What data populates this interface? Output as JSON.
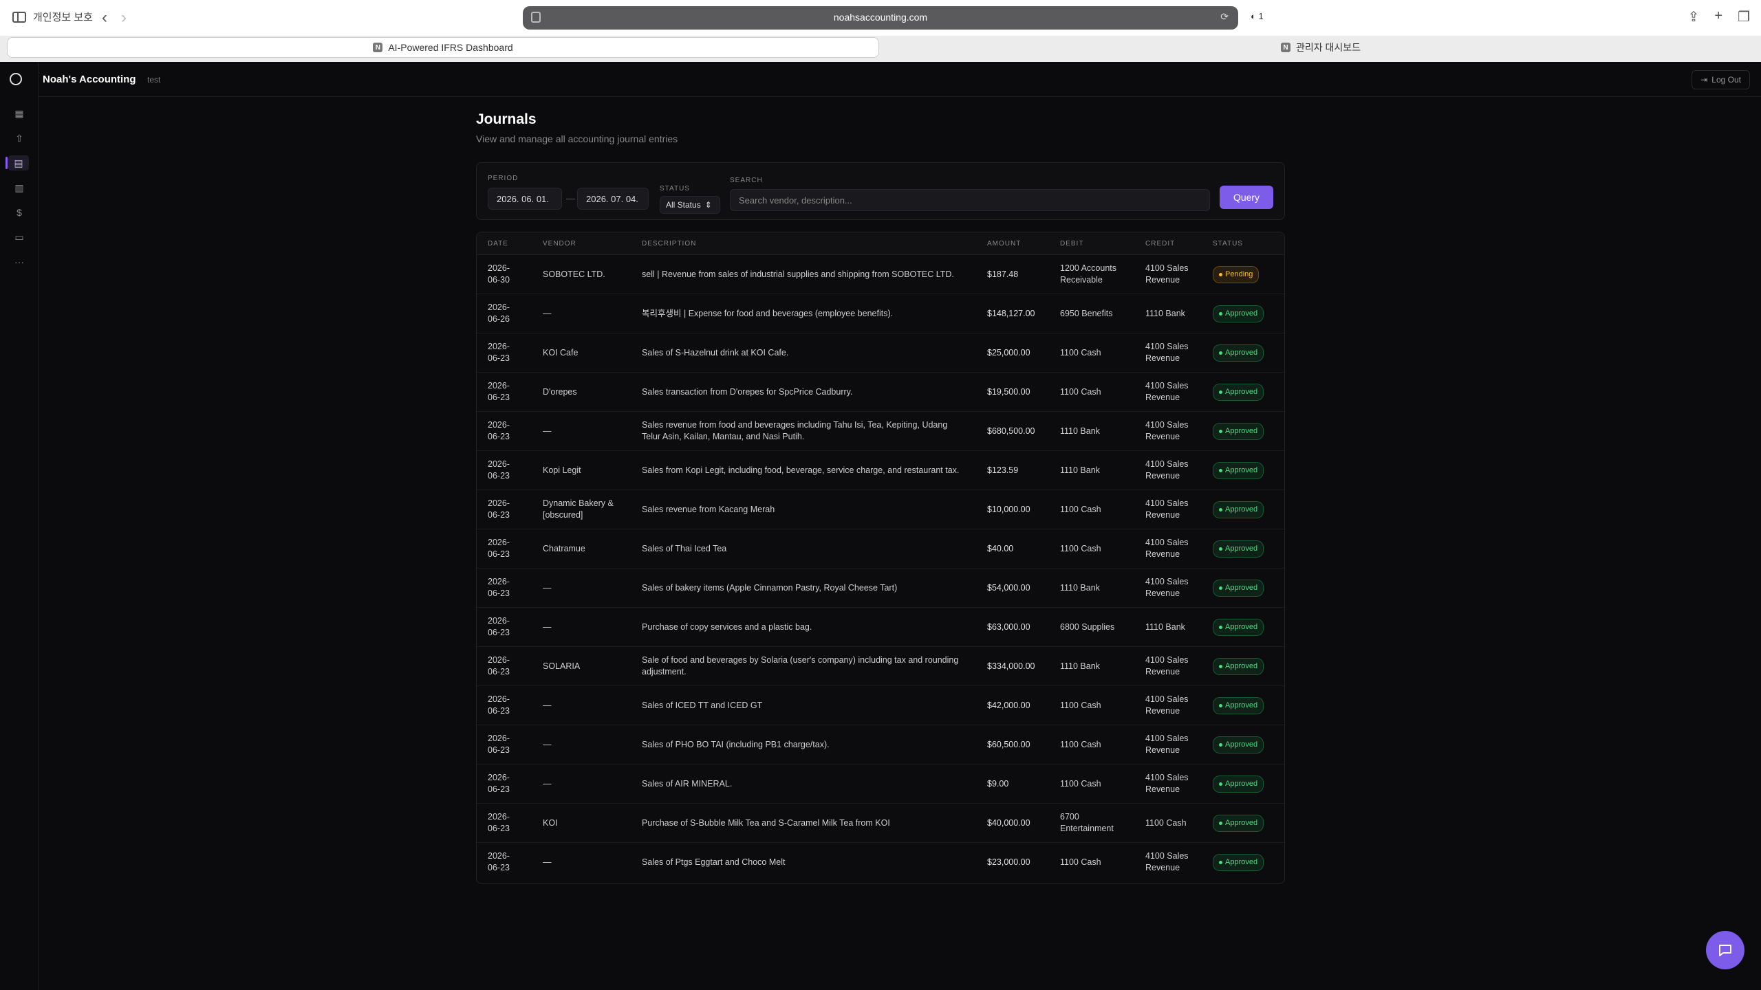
{
  "browser": {
    "privacy_label": "개인정보 보호",
    "url": "noahsaccounting.com",
    "shield_count": "1",
    "tabs": [
      {
        "label": "AI-Powered IFRS Dashboard",
        "favicon": "N"
      },
      {
        "label": "관리자 대시보드",
        "favicon": "N"
      }
    ]
  },
  "app": {
    "brand": "Noah's Accounting",
    "brand_sub": "test",
    "logout_label": "Log Out",
    "rail_icons": [
      "grid-icon",
      "upload-icon",
      "document-icon",
      "chart-icon",
      "dollar-icon",
      "card-icon",
      "more-icon"
    ],
    "accent_color": "#7c5ce8"
  },
  "page": {
    "title": "Journals",
    "subtitle": "View and manage all accounting journal entries"
  },
  "filters": {
    "period_label": "PERIOD",
    "period_from": "2026. 06. 01.",
    "period_to": "2026. 07. 04.",
    "status_label": "STATUS",
    "status_value": "All Status",
    "search_label": "SEARCH",
    "search_placeholder": "Search vendor, description...",
    "query_label": "Query"
  },
  "table": {
    "columns": [
      "DATE",
      "VENDOR",
      "DESCRIPTION",
      "AMOUNT",
      "DEBIT",
      "CREDIT",
      "STATUS"
    ],
    "rows": [
      {
        "date": "2026-06-30",
        "vendor": "SOBOTEC LTD.",
        "description": "sell | Revenue from sales of industrial supplies and shipping from SOBOTEC LTD.",
        "amount": "$187.48",
        "debit": "1200 Accounts Receivable",
        "credit": "4100 Sales Revenue",
        "status": "Pending"
      },
      {
        "date": "2026-06-26",
        "vendor": "—",
        "description": "복리후생비 | Expense for food and beverages (employee benefits).",
        "amount": "$148,127.00",
        "debit": "6950 Benefits",
        "credit": "1110 Bank",
        "status": "Approved"
      },
      {
        "date": "2026-06-23",
        "vendor": "KOI Cafe",
        "description": "Sales of S-Hazelnut drink at KOI Cafe.",
        "amount": "$25,000.00",
        "debit": "1100 Cash",
        "credit": "4100 Sales Revenue",
        "status": "Approved"
      },
      {
        "date": "2026-06-23",
        "vendor": "D'orepes",
        "description": "Sales transaction from D'orepes for SpcPrice Cadburry.",
        "amount": "$19,500.00",
        "debit": "1100 Cash",
        "credit": "4100 Sales Revenue",
        "status": "Approved"
      },
      {
        "date": "2026-06-23",
        "vendor": "—",
        "description": "Sales revenue from food and beverages including Tahu Isi, Tea, Kepiting, Udang Telur Asin, Kailan, Mantau, and Nasi Putih.",
        "amount": "$680,500.00",
        "debit": "1110 Bank",
        "credit": "4100 Sales Revenue",
        "status": "Approved"
      },
      {
        "date": "2026-06-23",
        "vendor": "Kopi Legit",
        "description": "Sales from Kopi Legit, including food, beverage, service charge, and restaurant tax.",
        "amount": "$123.59",
        "debit": "1110 Bank",
        "credit": "4100 Sales Revenue",
        "status": "Approved"
      },
      {
        "date": "2026-06-23",
        "vendor": "Dynamic Bakery & [obscured]",
        "description": "Sales revenue from Kacang Merah",
        "amount": "$10,000.00",
        "debit": "1100 Cash",
        "credit": "4100 Sales Revenue",
        "status": "Approved"
      },
      {
        "date": "2026-06-23",
        "vendor": "Chatramue",
        "description": "Sales of Thai Iced Tea",
        "amount": "$40.00",
        "debit": "1100 Cash",
        "credit": "4100 Sales Revenue",
        "status": "Approved"
      },
      {
        "date": "2026-06-23",
        "vendor": "—",
        "description": "Sales of bakery items (Apple Cinnamon Pastry, Royal Cheese Tart)",
        "amount": "$54,000.00",
        "debit": "1110 Bank",
        "credit": "4100 Sales Revenue",
        "status": "Approved"
      },
      {
        "date": "2026-06-23",
        "vendor": "—",
        "description": "Purchase of copy services and a plastic bag.",
        "amount": "$63,000.00",
        "debit": "6800 Supplies",
        "credit": "1110 Bank",
        "status": "Approved"
      },
      {
        "date": "2026-06-23",
        "vendor": "SOLARIA",
        "description": "Sale of food and beverages by Solaria (user's company) including tax and rounding adjustment.",
        "amount": "$334,000.00",
        "debit": "1110 Bank",
        "credit": "4100 Sales Revenue",
        "status": "Approved"
      },
      {
        "date": "2026-06-23",
        "vendor": "—",
        "description": "Sales of ICED TT and ICED GT",
        "amount": "$42,000.00",
        "debit": "1100 Cash",
        "credit": "4100 Sales Revenue",
        "status": "Approved"
      },
      {
        "date": "2026-06-23",
        "vendor": "—",
        "description": "Sales of PHO BO TAI (including PB1 charge/tax).",
        "amount": "$60,500.00",
        "debit": "1100 Cash",
        "credit": "4100 Sales Revenue",
        "status": "Approved"
      },
      {
        "date": "2026-06-23",
        "vendor": "—",
        "description": "Sales of AIR MINERAL.",
        "amount": "$9.00",
        "debit": "1100 Cash",
        "credit": "4100 Sales Revenue",
        "status": "Approved"
      },
      {
        "date": "2026-06-23",
        "vendor": "KOI",
        "description": "Purchase of S-Bubble Milk Tea and S-Caramel Milk Tea from KOI",
        "amount": "$40,000.00",
        "debit": "6700 Entertainment",
        "credit": "1100 Cash",
        "status": "Approved"
      },
      {
        "date": "2026-06-23",
        "vendor": "—",
        "description": "Sales of Ptgs Eggtart and Choco Melt",
        "amount": "$23,000.00",
        "debit": "1100 Cash",
        "credit": "4100 Sales Revenue",
        "status": "Approved"
      }
    ]
  }
}
